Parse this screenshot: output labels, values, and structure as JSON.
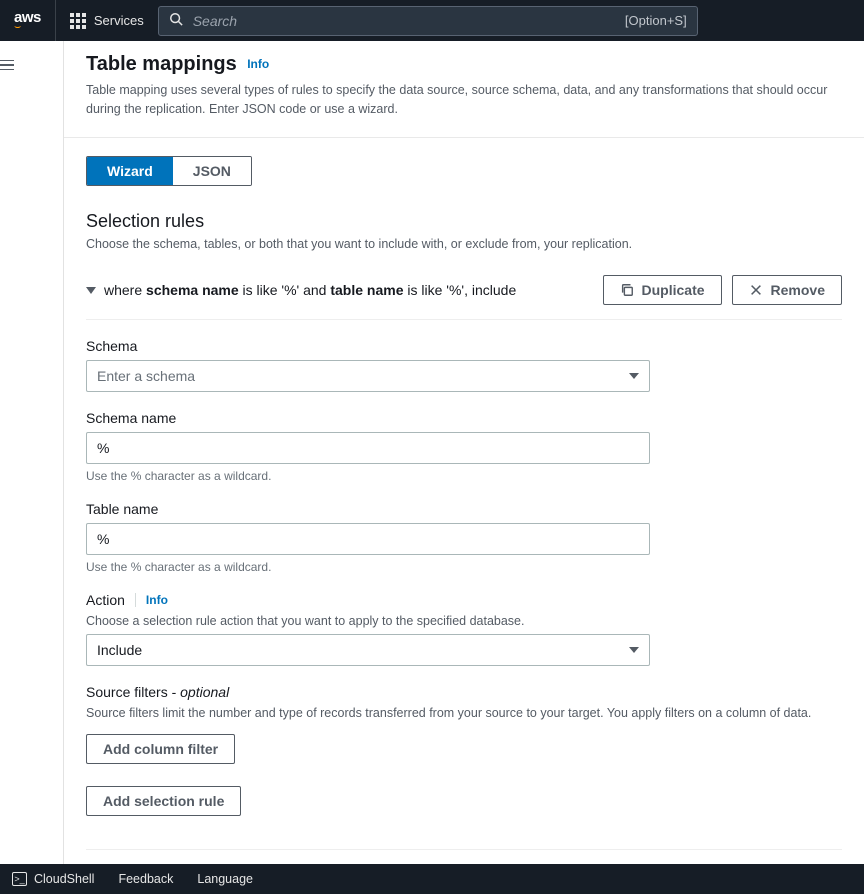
{
  "topnav": {
    "services_label": "Services",
    "search_placeholder": "Search",
    "search_hint": "[Option+S]"
  },
  "header": {
    "title": "Table mappings",
    "info_link": "Info",
    "subtitle": "Table mapping uses several types of rules to specify the data source, source schema, data, and any transformations that should occur during the replication. Enter JSON code or use a wizard."
  },
  "tabs": {
    "wizard": "Wizard",
    "json": "JSON"
  },
  "selection_rules": {
    "title": "Selection rules",
    "desc": "Choose the schema, tables, or both that you want to include with, or exclude from, your replication.",
    "rule_where": "where ",
    "rule_schema_name_lbl": "schema name",
    "rule_mid1": " is like '%' and ",
    "rule_table_name_lbl": "table name",
    "rule_mid2": " is like '%', include",
    "duplicate_btn": "Duplicate",
    "remove_btn": "Remove"
  },
  "fields": {
    "schema": {
      "label": "Schema",
      "placeholder": "Enter a schema"
    },
    "schema_name": {
      "label": "Schema name",
      "value": "%",
      "hint": "Use the % character as a wildcard."
    },
    "table_name": {
      "label": "Table name",
      "value": "%",
      "hint": "Use the % character as a wildcard."
    },
    "action": {
      "label": "Action",
      "info": "Info",
      "desc": "Choose a selection rule action that you want to apply to the specified database.",
      "value": "Include"
    },
    "source_filters": {
      "label": "Source filters - ",
      "optional": "optional",
      "desc": "Source filters limit the number and type of records transferred from your source to your target. You apply filters on a column of data."
    },
    "add_column_filter": "Add column filter",
    "add_selection_rule": "Add selection rule"
  },
  "bottombar": {
    "cloudshell": "CloudShell",
    "feedback": "Feedback",
    "language": "Language"
  }
}
